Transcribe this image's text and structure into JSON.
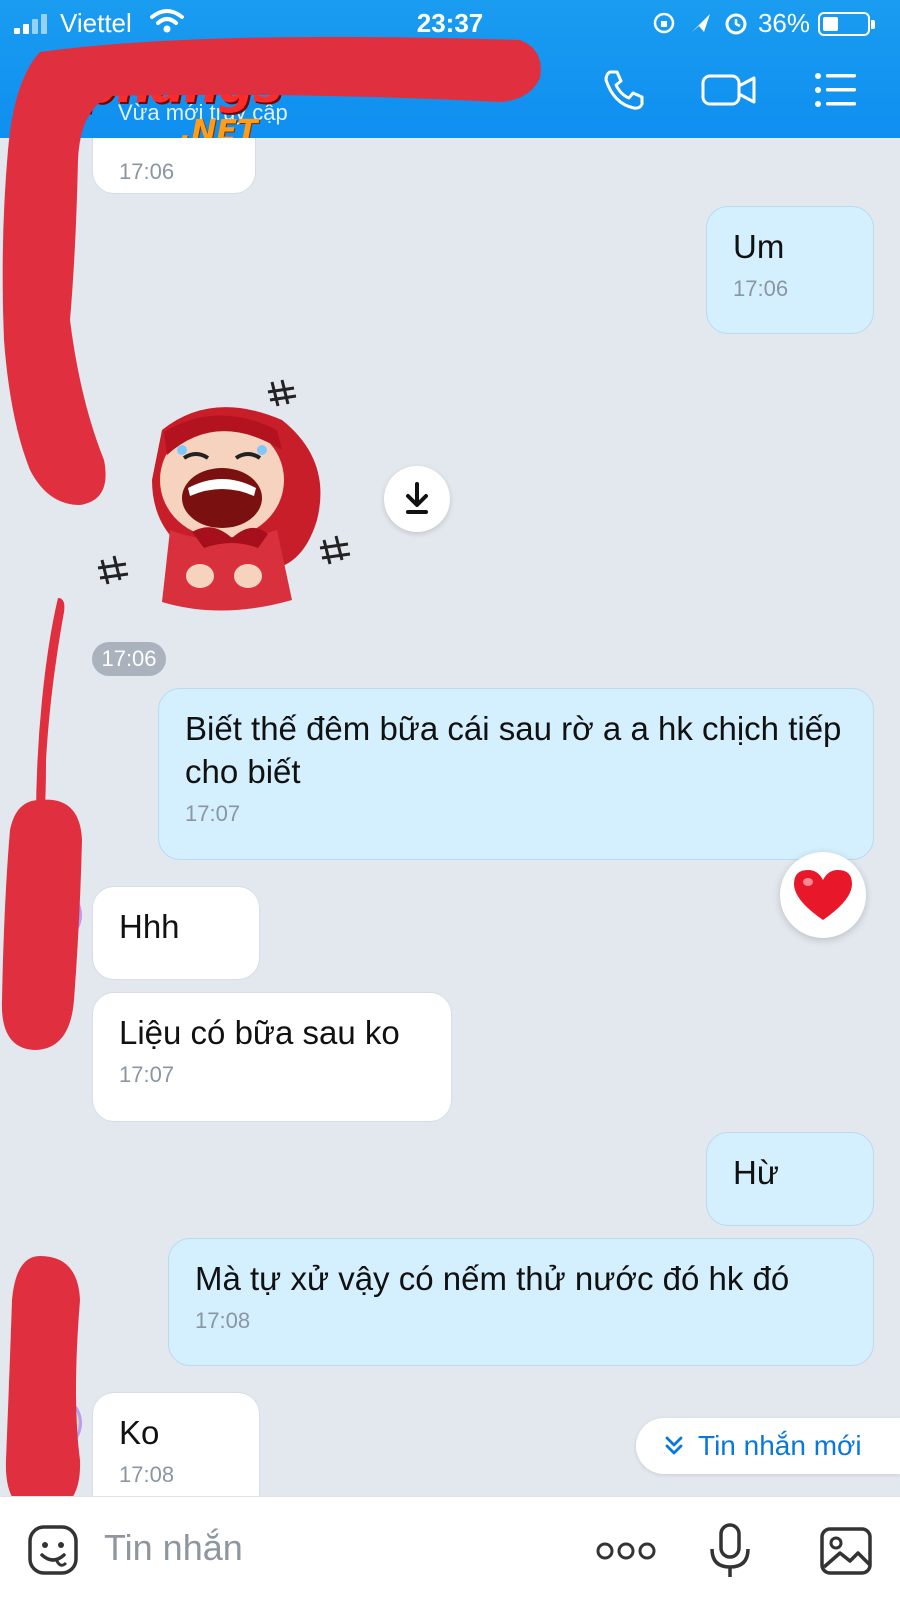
{
  "status_bar": {
    "carrier": "Viettel",
    "time": "23:37",
    "battery": "36%"
  },
  "header": {
    "subtitle": "Vừa mới truy cập",
    "watermark_main": "Rphangs",
    "watermark_sub": ".NET"
  },
  "messages": [
    {
      "side": "in",
      "text": "",
      "time": "17:06"
    },
    {
      "side": "out",
      "text": "Um",
      "time": "17:06"
    },
    {
      "side": "in",
      "type": "sticker",
      "time_chip": "17:06"
    },
    {
      "side": "out",
      "text": "Biết thế đêm bữa cái sau rờ a a hk chịch tiếp cho biết",
      "time": "17:07",
      "reaction": "heart"
    },
    {
      "side": "in",
      "text": "Hhh",
      "time": ""
    },
    {
      "side": "in",
      "text": "Liệu có bữa sau ko",
      "time": "17:07"
    },
    {
      "side": "out",
      "text": "Hừ",
      "time": ""
    },
    {
      "side": "out",
      "text": "Mà tự xử vậy có nếm thử nước đó hk đó",
      "time": "17:08"
    },
    {
      "side": "in",
      "text": "Ko",
      "time": "17:08"
    }
  ],
  "new_messages_label": "Tin nhắn mới",
  "input": {
    "placeholder": "Tin nhắn"
  },
  "colors": {
    "header_blue": "#1a9cf0",
    "outgoing_bubble": "#d4effd",
    "incoming_bubble": "#ffffff",
    "redaction_red": "#e03040",
    "link_blue": "#0a78d8"
  }
}
